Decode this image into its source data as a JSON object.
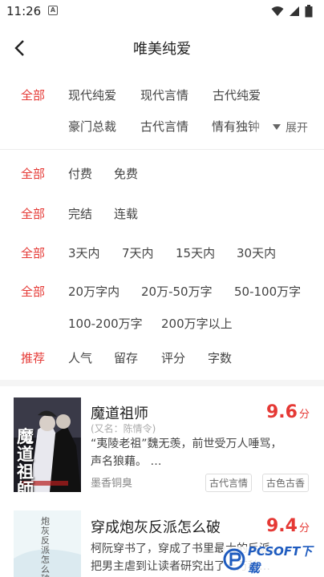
{
  "status": {
    "time": "11:26",
    "a_badge": "A"
  },
  "header": {
    "title": "唯美纯爱"
  },
  "filters": {
    "category": {
      "all": "全部",
      "options": [
        "现代纯爱",
        "现代言情",
        "古代纯爱",
        "豪门总裁",
        "古代言情",
        "情有独钟"
      ],
      "expand": "展开"
    },
    "fee": {
      "all": "全部",
      "options": [
        "付费",
        "免费"
      ]
    },
    "status": {
      "all": "全部",
      "options": [
        "完结",
        "连载"
      ]
    },
    "update": {
      "all": "全部",
      "options": [
        "3天内",
        "7天内",
        "15天内",
        "30天内"
      ]
    },
    "wordcount": {
      "all": "全部",
      "options": [
        "20万字内",
        "20万-50万字",
        "50-100万字",
        "100-200万字",
        "200万字以上"
      ]
    },
    "sort": {
      "label": "推荐",
      "options": [
        "人气",
        "留存",
        "评分",
        "字数"
      ]
    }
  },
  "books": [
    {
      "title": "魔道祖师",
      "alias": "(又名：陈情令)",
      "desc_line1": "“夷陵老祖”魏无羡，前世受万人唾骂，",
      "desc_line2": "声名狼藉。 …",
      "author": "墨香铜臭",
      "score": "9.6",
      "score_unit": "分",
      "tags": [
        "古代言情",
        "古色古香"
      ],
      "cover_text": "魔道祖師"
    },
    {
      "title": "穿成炮灰反派怎么破",
      "desc_line1": "柯阮穿书了，穿成了书里最大的反派，",
      "desc_line2": "把男主虐到让读者研究出了十万种…",
      "score": "9.4",
      "score_unit": "分",
      "cover_text": "炮灰反派怎么破"
    }
  ],
  "watermark": {
    "text": "PCSOFT下载"
  }
}
